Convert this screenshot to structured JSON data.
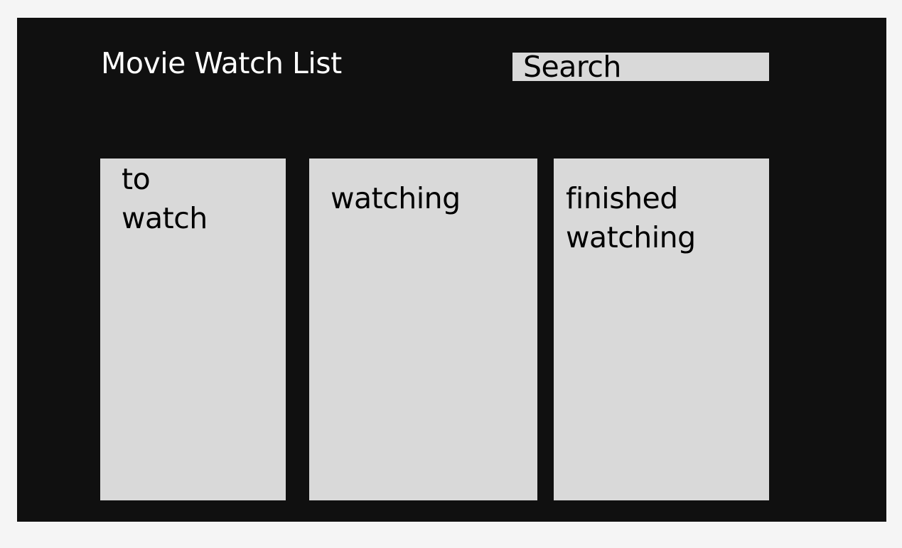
{
  "header": {
    "title": "Movie Watch List",
    "search_placeholder": "Search"
  },
  "columns": [
    {
      "title": "to watch"
    },
    {
      "title": "watching"
    },
    {
      "title": "finished watching"
    }
  ],
  "colors": {
    "page_background": "#f5f5f5",
    "frame_background": "#101010",
    "panel_background": "#d9d9d9",
    "title_text": "#ffffff",
    "panel_text": "#000000"
  }
}
